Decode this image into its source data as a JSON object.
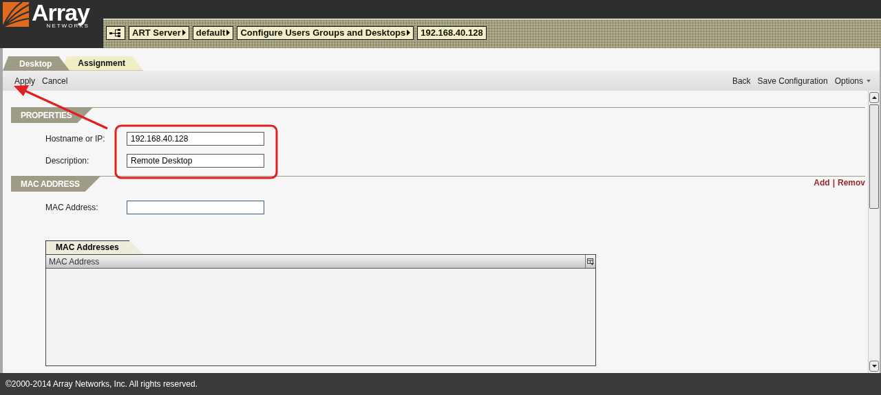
{
  "logo": {
    "name": "Array",
    "subtitle": "NETWORKS"
  },
  "breadcrumb": [
    {
      "kind": "icon"
    },
    {
      "kind": "link",
      "label": "ART Server"
    },
    {
      "kind": "link",
      "label": "default"
    },
    {
      "kind": "link",
      "label": "Configure Users Groups and Desktops"
    },
    {
      "kind": "current",
      "label": "192.168.40.128"
    }
  ],
  "tabs": [
    {
      "label": "Desktop",
      "selected": true
    },
    {
      "label": "Assignment",
      "selected": false
    }
  ],
  "toolbar": {
    "left": [
      "Apply",
      "Cancel"
    ],
    "right": [
      {
        "kind": "link",
        "label": "Back"
      },
      {
        "kind": "link",
        "label": "Save Configuration"
      },
      {
        "kind": "menu",
        "label": "Options"
      }
    ]
  },
  "sections": [
    {
      "title": "PROPERTIES",
      "fields": [
        {
          "label": "Hostname or IP:",
          "value": "192.168.40.128"
        },
        {
          "label": "Description:",
          "value": "Remote Desktop"
        }
      ]
    },
    {
      "title": "MAC ADDRESS",
      "actions": [
        "Add",
        "Remov"
      ],
      "action_separator": "|",
      "fields": [
        {
          "label": "MAC Address:"
        }
      ],
      "table": {
        "tab": "MAC Addresses",
        "columns": [
          "MAC Address"
        ]
      }
    }
  ],
  "footer": "©2000-2014 Array Networks, Inc. All rights reserved."
}
